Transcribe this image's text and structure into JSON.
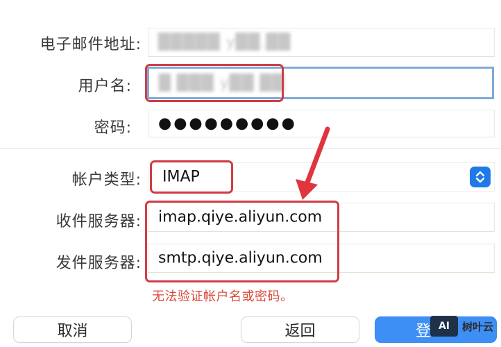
{
  "form": {
    "email": {
      "label": "电子邮件地址:",
      "value": "█████ y██.██"
    },
    "username": {
      "label": "用户名:",
      "value": "█ ███ y██ ██"
    },
    "password": {
      "label": "密码:",
      "value": "●●●●●●●●●"
    },
    "account_type": {
      "label": "帐户类型:",
      "value": "IMAP"
    },
    "incoming_server": {
      "label": "收件服务器:",
      "value": "imap.qiye.aliyun.com"
    },
    "outgoing_server": {
      "label": "发件服务器:",
      "value": "smtp.qiye.aliyun.com"
    }
  },
  "error_message": "无法验证帐户名或密码。",
  "buttons": {
    "cancel": "取消",
    "back": "返回",
    "sign_in": "登"
  },
  "watermark": {
    "logo": "AI",
    "text": "树叶云"
  },
  "colors": {
    "highlight": "#d23c44",
    "error": "#d9483b",
    "accent": "#1f79e8",
    "primary_button": "#3d8ff5",
    "focus_ring": "#7eaad8",
    "arrow": "#e0353f"
  },
  "icons": {
    "stepper": "up-down-chevron-icon",
    "arrow": "red-arrow-annotation"
  }
}
